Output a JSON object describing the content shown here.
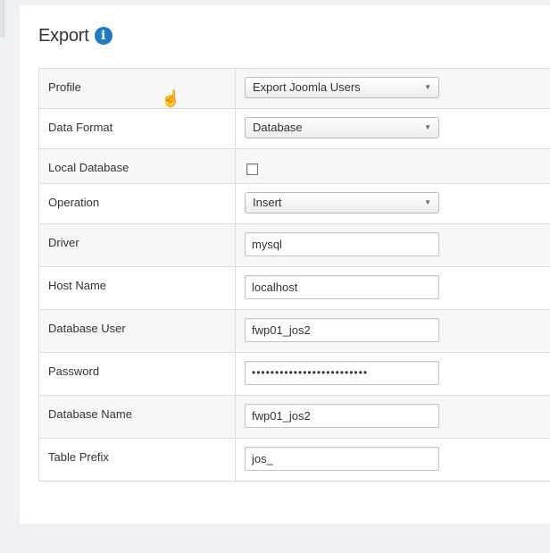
{
  "header": {
    "title": "Export",
    "info_icon": "i"
  },
  "form": {
    "profile": {
      "label": "Profile",
      "value": "Export Joomla Users"
    },
    "data_format": {
      "label": "Data Format",
      "value": "Database"
    },
    "local_database": {
      "label": "Local Database",
      "checked": false
    },
    "operation": {
      "label": "Operation",
      "value": "Insert"
    },
    "driver": {
      "label": "Driver",
      "value": "mysql"
    },
    "host_name": {
      "label": "Host Name",
      "value": "localhost"
    },
    "database_user": {
      "label": "Database User",
      "value": "fwp01_jos2"
    },
    "password": {
      "label": "Password",
      "value": "•••••••••••••••••••••••••"
    },
    "database_name": {
      "label": "Database Name",
      "value": "fwp01_jos2"
    },
    "table_prefix": {
      "label": "Table Prefix",
      "value": "jos_"
    }
  },
  "icons": {
    "dropdown": "chevron-down-icon",
    "info": "info-icon",
    "cursor": "hand-pointer-icon"
  },
  "colors": {
    "info_icon": "#1f7cc4",
    "page_bg": "#eef0f4",
    "panel_bg": "#ffffff",
    "row_alt": "#f7f7f7"
  }
}
